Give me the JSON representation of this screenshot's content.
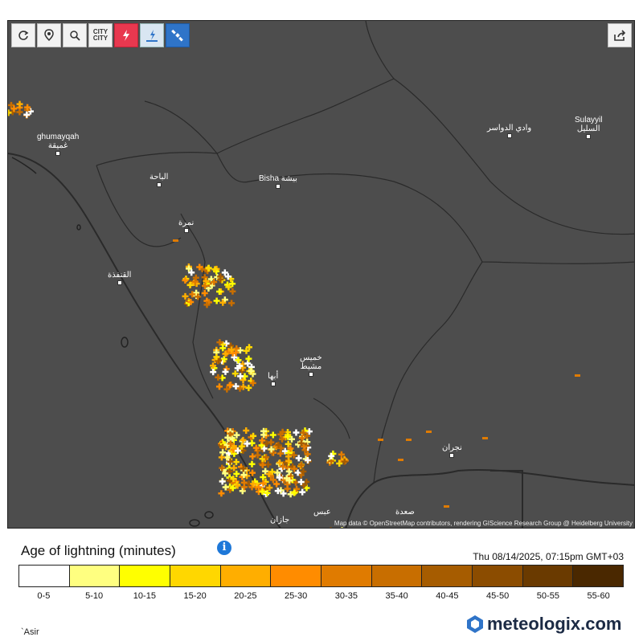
{
  "toolbar": {
    "buttons": [
      {
        "icon": "refresh-icon"
      },
      {
        "icon": "location-pin-icon"
      },
      {
        "icon": "zoom-icon"
      },
      {
        "icon": "city-toggle-icon",
        "label": "CITY\nCITY"
      },
      {
        "icon": "lightning-icon",
        "color": "#e8384f"
      },
      {
        "icon": "thunderstorm-icon"
      },
      {
        "icon": "satellite-icon",
        "color": "#2f74c8"
      }
    ],
    "share_icon": "share-icon"
  },
  "places": [
    {
      "name": "ghumayqah\nغميقة"
    },
    {
      "name": "الباحة"
    },
    {
      "name": "Bisha بيشة"
    },
    {
      "name": "وادي الدواسر"
    },
    {
      "name": "Sulayyil\nالسليل"
    },
    {
      "name": "نمرة"
    },
    {
      "name": "القنفذة"
    },
    {
      "name": "خميس\nمشيط"
    },
    {
      "name": "أبها"
    },
    {
      "name": "نجران"
    },
    {
      "name": "صعدة"
    },
    {
      "name": "جازان"
    },
    {
      "name": "عبس"
    }
  ],
  "attribution": "Map data © OpenStreetMap contributors, rendering GIScience Research Group @ Heidelberg University",
  "legend": {
    "title": "Age of lightning (minutes)",
    "timestamp": "Thu 08/14/2025, 07:15pm GMT+03",
    "bins": [
      {
        "label": "0-5",
        "color": "#ffffff"
      },
      {
        "label": "5-10",
        "color": "#ffff80"
      },
      {
        "label": "10-15",
        "color": "#ffff00"
      },
      {
        "label": "15-20",
        "color": "#ffd700"
      },
      {
        "label": "20-25",
        "color": "#ffae00"
      },
      {
        "label": "25-30",
        "color": "#ff8c00"
      },
      {
        "label": "30-35",
        "color": "#e07b00"
      },
      {
        "label": "35-40",
        "color": "#c86e00"
      },
      {
        "label": "40-45",
        "color": "#a65c00"
      },
      {
        "label": "45-50",
        "color": "#8b4c00"
      },
      {
        "label": "50-55",
        "color": "#6a3a00"
      },
      {
        "label": "55-60",
        "color": "#4a2800"
      }
    ]
  },
  "region": "`Asir",
  "brand": "meteologix.com"
}
